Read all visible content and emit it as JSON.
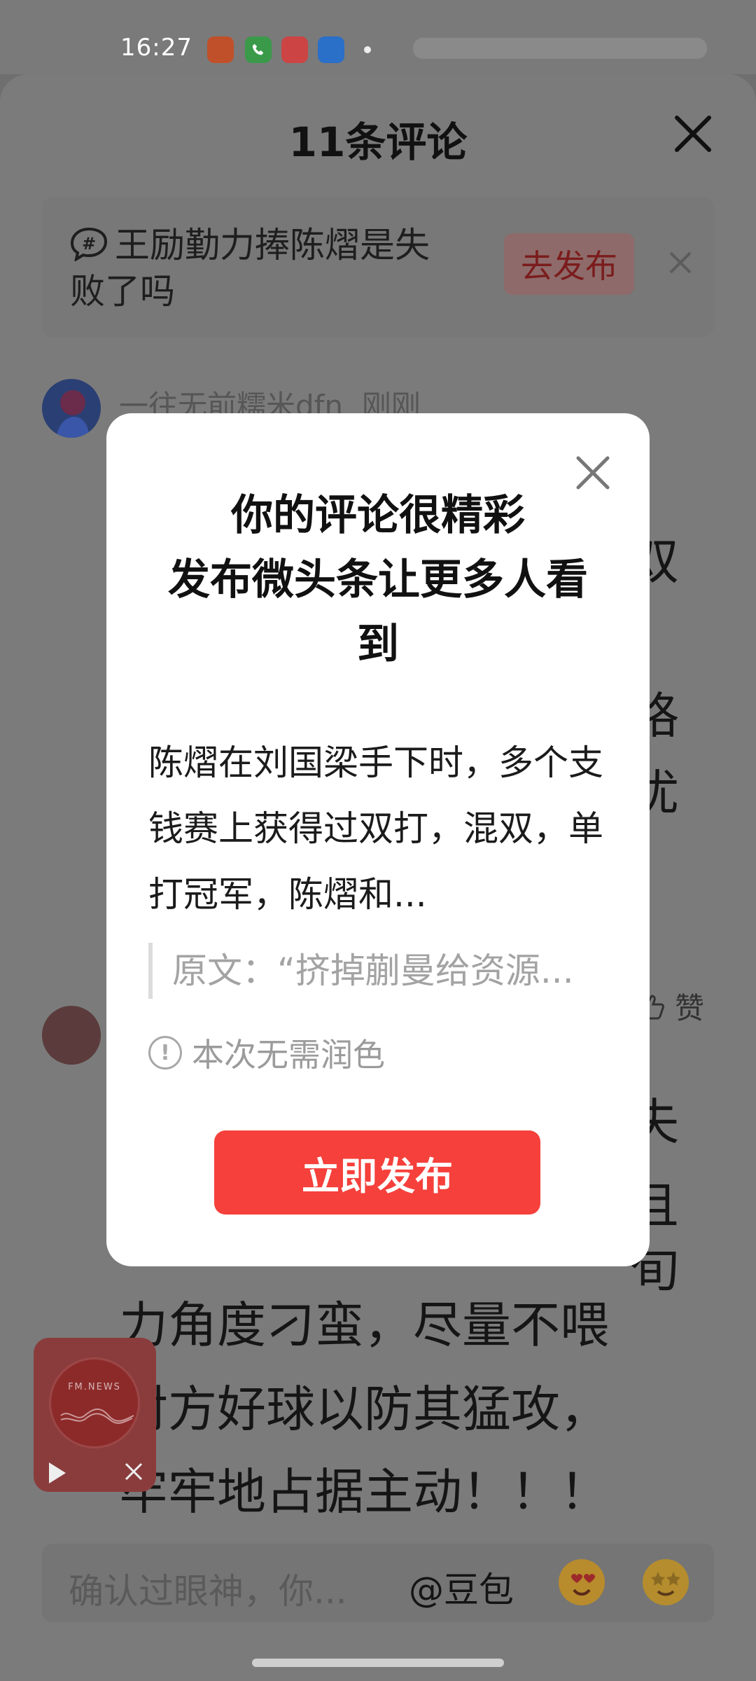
{
  "status_bar": {
    "time": "16:27",
    "app_icons": [
      "calendar-icon",
      "phone-icon",
      "toutiao-icon",
      "browser-icon"
    ]
  },
  "sheet": {
    "title": "11条评论"
  },
  "topic": {
    "text": "王励勤力捧陈熠是失败了吗",
    "publish_label": "去发布"
  },
  "comments": [
    {
      "author": "一往无前糯米dfn",
      "time": "刚刚"
    }
  ],
  "background_text": {
    "line1": "力角度刁蛮，尽量不喂",
    "line2": "对方好球以防其猛攻，",
    "line3": "牢牢地占据主动！！！",
    "like_label": "赞"
  },
  "mini_player": {
    "label": "FM.NEWS"
  },
  "input_bar": {
    "placeholder": "确认过眼神，你...",
    "at_label": "@豆包"
  },
  "modal": {
    "title_line1": "你的评论很精彩",
    "title_line2": "发布微头条让更多人看到",
    "body": "陈熠在刘国梁手下时，多个支钱赛上获得过双打，混双，单打冠军，陈熠和...",
    "quote": "原文：“挤掉蒯曼给资源...",
    "note": "本次无需润色",
    "cta_label": "立即发布"
  },
  "colors": {
    "accent": "#f5403b",
    "overlay": "#7b7b7b",
    "modal_bg": "#ffffff"
  }
}
